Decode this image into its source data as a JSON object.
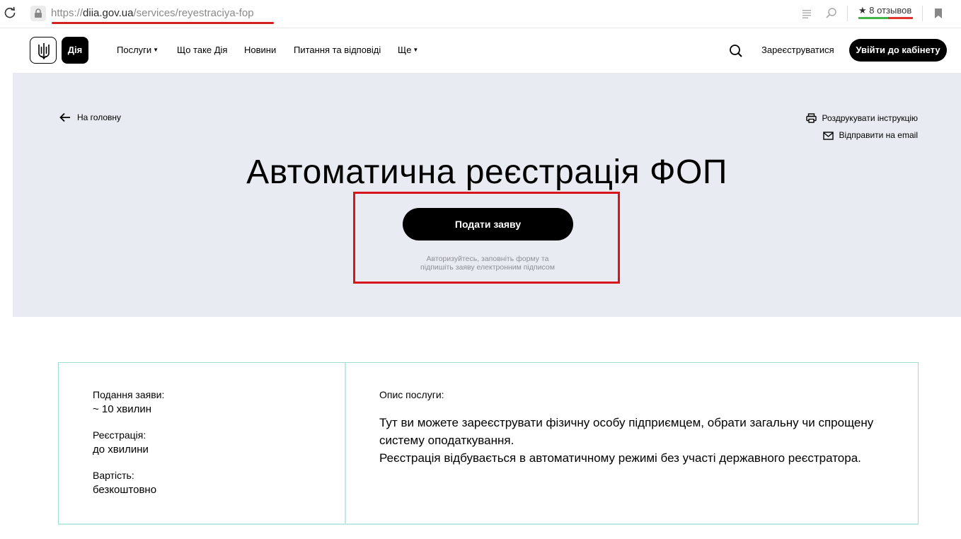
{
  "browser": {
    "url_scheme": "https://",
    "url_domain": "diia.gov.ua",
    "url_path": "/services/reyestraciya-fop",
    "reviews": "8 отзывов",
    "icons": [
      "reload-icon",
      "lock-icon",
      "reader-icon",
      "search-icon",
      "bookmark-icon"
    ]
  },
  "header": {
    "logo_text": "Дія",
    "nav": {
      "services": "Послуги",
      "about": "Що таке Дія",
      "news": "Новини",
      "faq": "Питання та відповіді",
      "more": "Ще"
    },
    "register": "Зареєструватися",
    "login": "Увійти до кабінету"
  },
  "hero": {
    "back": "На головну",
    "print": "Роздрукувати інструкцію",
    "email": "Відправити на email",
    "title": "Автоматична реєстрація ФОП",
    "apply_button": "Подати заяву",
    "hint_line1": "Авторизуйтесь, заповніть форму та",
    "hint_line2": "підпишіть заяву електронним підписом"
  },
  "info": {
    "submission_label": "Подання заяви:",
    "submission_value": "~ 10 хвилин",
    "registration_label": "Реєстрація:",
    "registration_value": "до хвилини",
    "cost_label": "Вартість:",
    "cost_value": "безкоштовно",
    "description_label": "Опис послуги:",
    "description_p1": "Тут ви можете зареєструвати фізичну особу підприємцем, обрати загальну чи спрощену систему оподаткування.",
    "description_p2": "Реєстрація відбувається в автоматичному режимі без участі державного реєстратора."
  },
  "colors": {
    "hero_bg": "#e8ecf2",
    "highlight": "#d8141c",
    "card_border": "#9fdcd4",
    "button": "#000000"
  }
}
